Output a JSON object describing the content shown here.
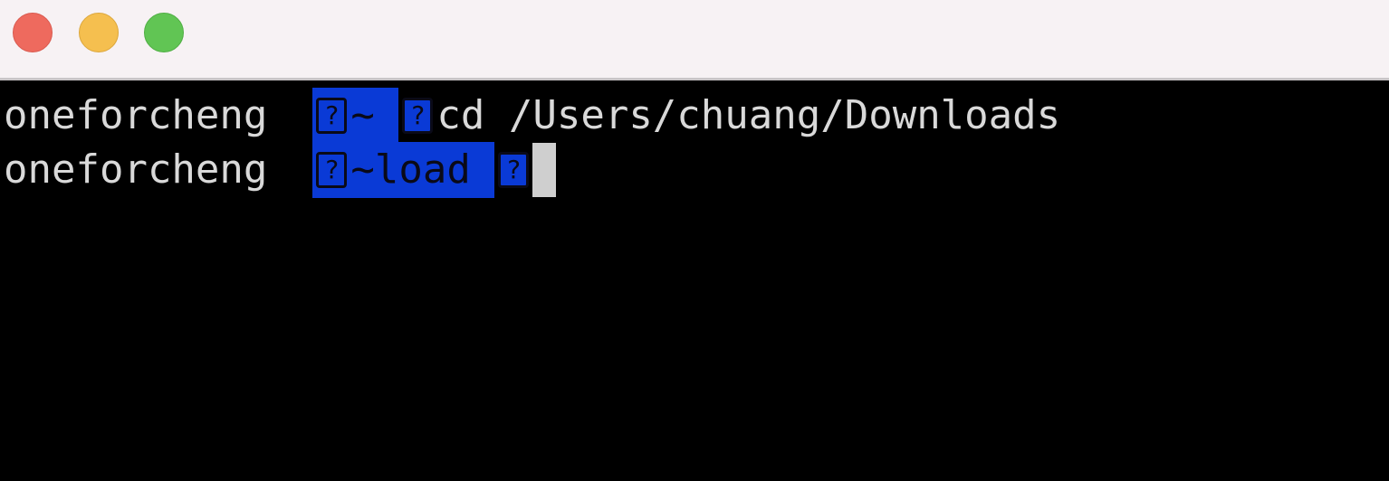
{
  "window": {
    "buttons": {
      "close": "close",
      "minimize": "minimize",
      "zoom": "zoom"
    }
  },
  "terminal": {
    "lines": [
      {
        "user": "oneforcheng",
        "glyph": "?",
        "path": "~ ",
        "prompt_glyph": "?",
        "command": "cd /Users/chuang/Downloads"
      },
      {
        "user": "oneforcheng",
        "glyph": "?",
        "path": "~load ",
        "prompt_glyph": "?",
        "command": ""
      }
    ]
  },
  "colors": {
    "titlebar": "#f7f2f4",
    "background": "#000000",
    "highlight": "#0a3ad6",
    "text": "#d9d9d9",
    "cursor": "#cfcfcf",
    "close": "#ee6a5e",
    "minimize": "#f5bf4f",
    "zoom": "#61c554"
  }
}
